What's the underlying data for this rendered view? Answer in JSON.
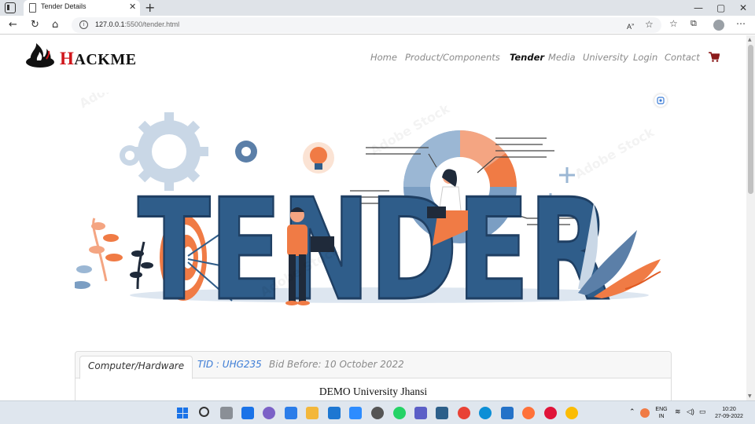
{
  "browser": {
    "tab_title": "Tender Details",
    "tab_close": "✕",
    "new_tab": "+",
    "url_host": "127.0.0.1",
    "url_rest": ":5500/tender.html",
    "window_controls": [
      "—",
      "▢",
      "✕"
    ],
    "icons": [
      "back-icon",
      "refresh-icon",
      "home-icon",
      "info-icon",
      "read-aloud-icon",
      "favorite-icon",
      "favorites-icon",
      "collections-icon",
      "profile-icon",
      "more-icon"
    ]
  },
  "site": {
    "logo_first": "H",
    "logo_rest": "ACKME",
    "nav": [
      {
        "label": "Home",
        "active": false
      },
      {
        "label": "Product/Components",
        "active": false
      },
      {
        "label": "Tender",
        "active": true
      },
      {
        "label": "Media",
        "active": false
      },
      {
        "label": "University",
        "active": false
      },
      {
        "label": "Login",
        "active": false
      },
      {
        "label": "Contact",
        "active": false
      }
    ],
    "cart_icon": "cart-icon",
    "hero_word": "TENDER",
    "watermark": "Adobe Stock"
  },
  "card": {
    "tabs": [
      {
        "label": "Computer/Hardware",
        "active": true
      },
      {
        "label": "TID : UHG235",
        "active": false
      },
      {
        "label": "Bid Before: 10 October 2022",
        "active": false
      }
    ],
    "university": "DEMO University Jhansi"
  },
  "taskbar": {
    "lang": "ENG",
    "region": "IN",
    "time": "10:20",
    "date": "27-09-2022"
  },
  "colors": {
    "brand_red": "#d0161b",
    "hero_blue": "#2f5d8a",
    "hero_orange": "#f07b45",
    "link_blue": "#3a7bd5"
  }
}
